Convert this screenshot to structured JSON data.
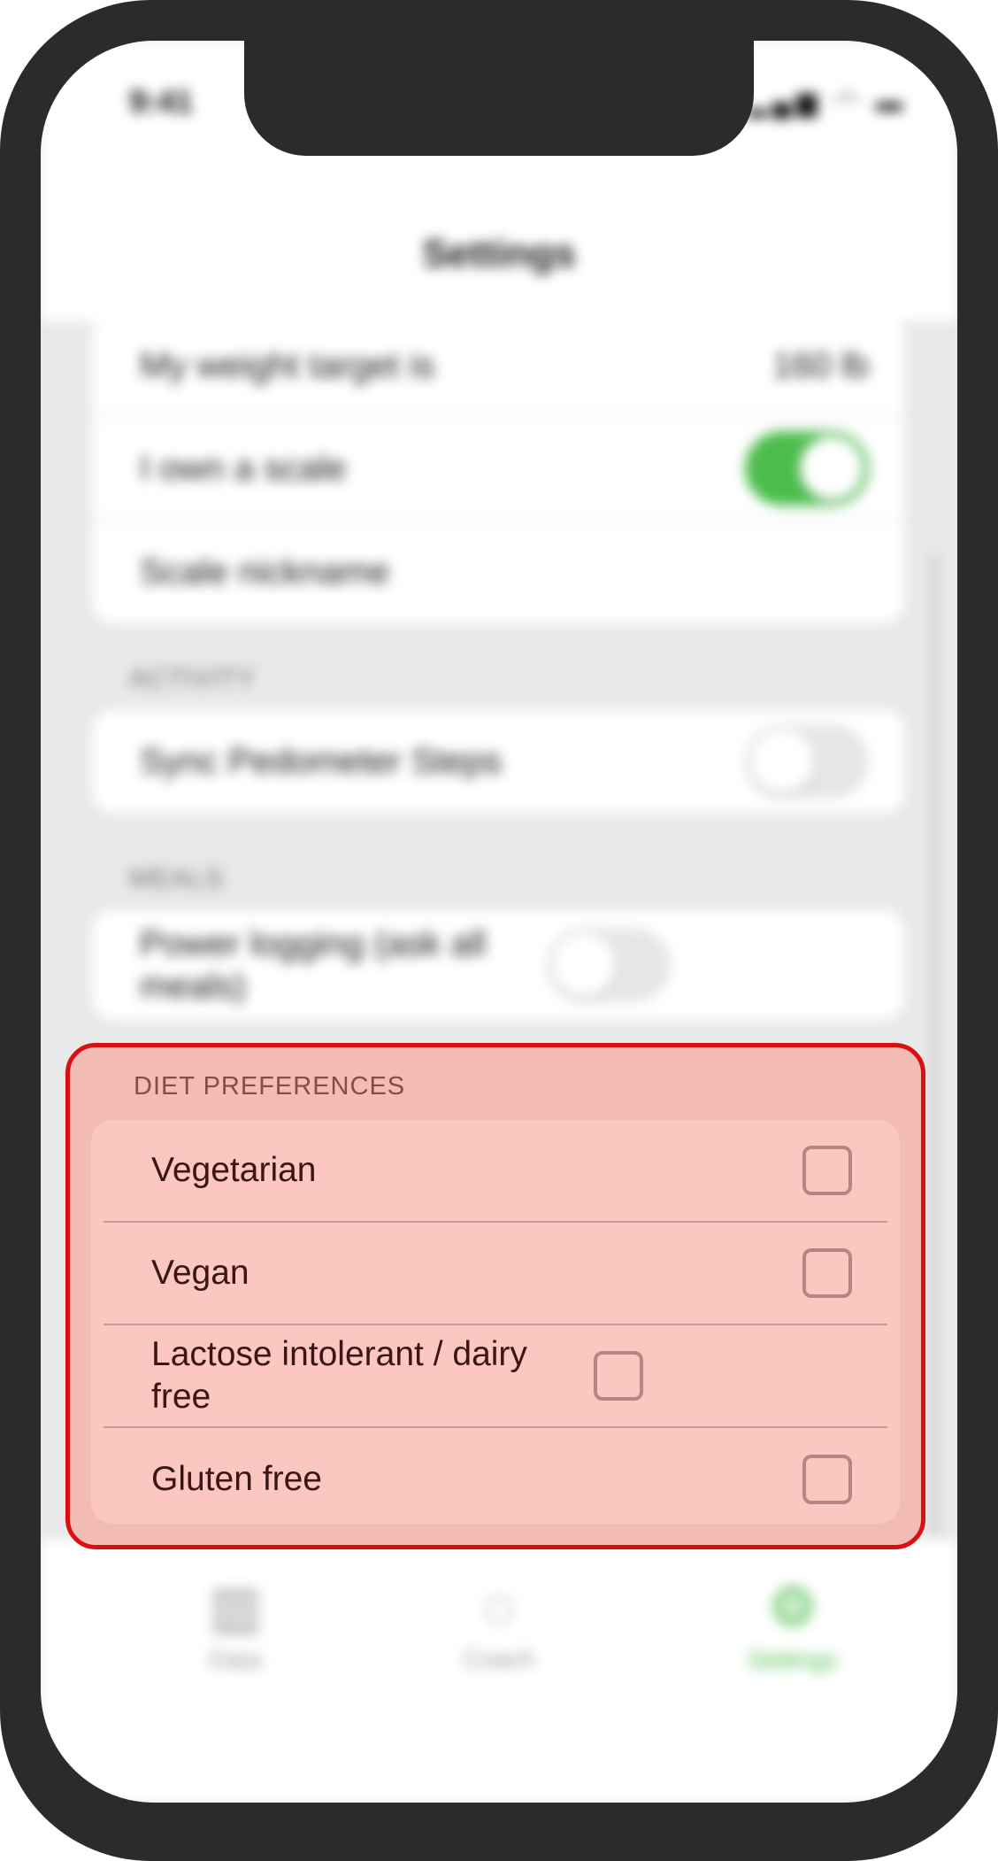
{
  "status_bar": {
    "time": "9:41",
    "icons": "▂▄▆ ◠ ▬"
  },
  "nav": {
    "title": "Settings"
  },
  "weight_group": {
    "rows": [
      {
        "label": "My weight target is",
        "value": "160 lb"
      },
      {
        "label": "I own a scale",
        "toggle": true
      },
      {
        "label": "Scale nickname"
      }
    ]
  },
  "activity": {
    "header": "ACTIVITY",
    "rows": [
      {
        "label": "Sync Pedometer Steps",
        "toggle": false
      }
    ]
  },
  "meals": {
    "header": "MEALS",
    "rows": [
      {
        "label": "Power logging (ask all meals)",
        "toggle": false
      }
    ]
  },
  "diet": {
    "header": "DIET PREFERENCES",
    "rows": [
      {
        "label": "Vegetarian",
        "checked": false
      },
      {
        "label": "Vegan",
        "checked": false
      },
      {
        "label": "Lactose intolerant / dairy free",
        "checked": false
      },
      {
        "label": "Gluten free",
        "checked": false
      }
    ]
  },
  "tabs": [
    {
      "label": "Data",
      "icon": "chart-icon"
    },
    {
      "label": "Coach",
      "icon": "chat-icon"
    },
    {
      "label": "Settings",
      "icon": "gear-icon",
      "active": true
    }
  ],
  "colors": {
    "accent": "#4cbd4c",
    "highlight_border": "#d81010",
    "highlight_fill": "#f2bbb5"
  }
}
